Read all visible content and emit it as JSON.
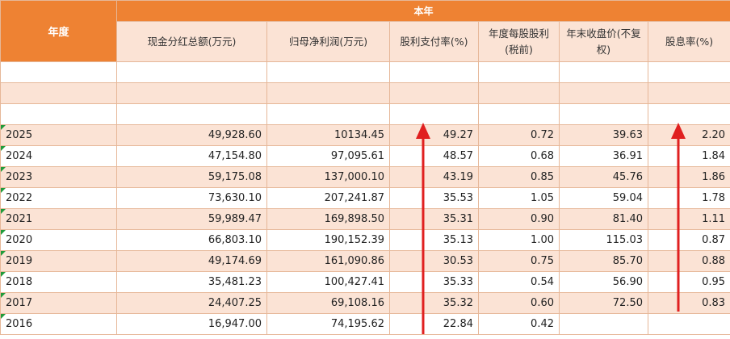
{
  "header": {
    "year_label": "年度",
    "group_label": "本年",
    "columns": [
      "现金分红总额(万元)",
      "归母净利润(万元)",
      "股利支付率(%)",
      "年度每股股利(税前)",
      "年末收盘价(不复权)",
      "股息率(%)"
    ]
  },
  "rows": [
    {
      "year": "2025",
      "dividend_total": "49,928.60",
      "net_profit": "10134.45",
      "payout_ratio": "49.27",
      "dps": "0.72",
      "close_price": "39.63",
      "yield": "2.20"
    },
    {
      "year": "2024",
      "dividend_total": "47,154.80",
      "net_profit": "97,095.61",
      "payout_ratio": "48.57",
      "dps": "0.68",
      "close_price": "36.91",
      "yield": "1.84"
    },
    {
      "year": "2023",
      "dividend_total": "59,175.08",
      "net_profit": "137,000.10",
      "payout_ratio": "43.19",
      "dps": "0.85",
      "close_price": "45.76",
      "yield": "1.86"
    },
    {
      "year": "2022",
      "dividend_total": "73,630.10",
      "net_profit": "207,241.87",
      "payout_ratio": "35.53",
      "dps": "1.05",
      "close_price": "59.04",
      "yield": "1.78"
    },
    {
      "year": "2021",
      "dividend_total": "59,989.47",
      "net_profit": "169,898.50",
      "payout_ratio": "35.31",
      "dps": "0.90",
      "close_price": "81.40",
      "yield": "1.11"
    },
    {
      "year": "2020",
      "dividend_total": "66,803.10",
      "net_profit": "190,152.39",
      "payout_ratio": "35.13",
      "dps": "1.00",
      "close_price": "115.03",
      "yield": "0.87"
    },
    {
      "year": "2019",
      "dividend_total": "49,174.69",
      "net_profit": "161,090.86",
      "payout_ratio": "30.53",
      "dps": "0.75",
      "close_price": "85.70",
      "yield": "0.88"
    },
    {
      "year": "2018",
      "dividend_total": "35,481.23",
      "net_profit": "100,427.41",
      "payout_ratio": "35.33",
      "dps": "0.54",
      "close_price": "56.90",
      "yield": "0.95"
    },
    {
      "year": "2017",
      "dividend_total": "24,407.25",
      "net_profit": "69,108.16",
      "payout_ratio": "35.32",
      "dps": "0.60",
      "close_price": "72.50",
      "yield": "0.83"
    },
    {
      "year": "2016",
      "dividend_total": "16,947.00",
      "net_profit": "74,195.62",
      "payout_ratio": "22.84",
      "dps": "0.42",
      "close_price": "",
      "yield": ""
    }
  ],
  "colors": {
    "header_orange": "#ee8233",
    "peach": "#fbe3d5",
    "grid": "#e6b798",
    "arrow_red": "#e02020",
    "indicator_green": "#1f9b3a"
  },
  "annotations": [
    {
      "type": "arrow",
      "direction": "up",
      "column": "股利支付率(%)",
      "color": "red"
    },
    {
      "type": "arrow",
      "direction": "up",
      "column": "股息率(%)",
      "color": "red"
    }
  ]
}
